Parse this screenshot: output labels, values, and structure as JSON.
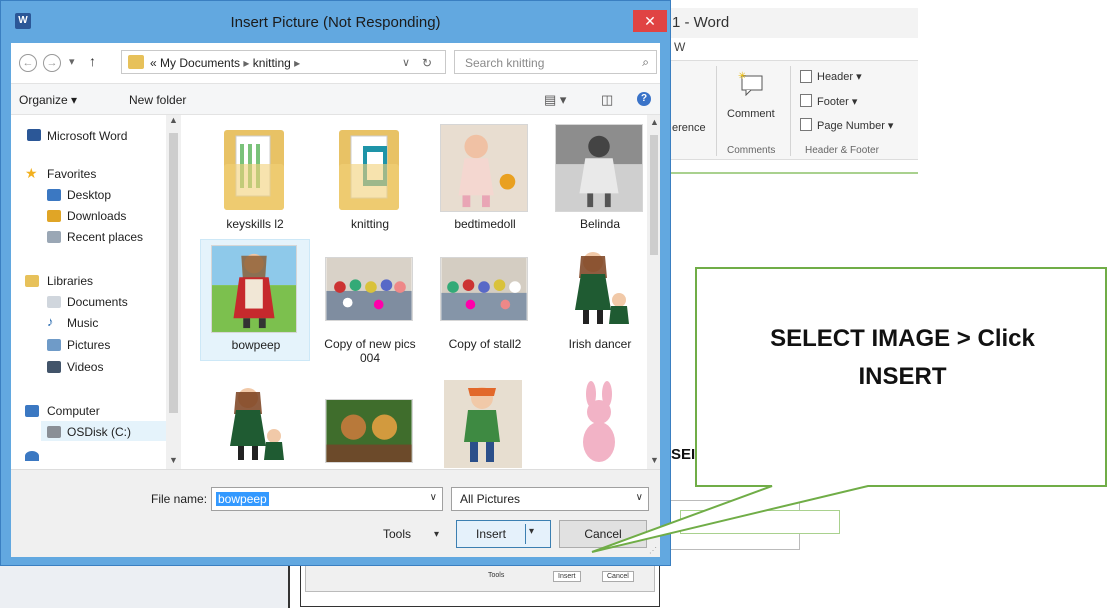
{
  "word": {
    "title": "1 - Word",
    "tab_fragment": "W",
    "ribbon": {
      "reference_fragment": "erence",
      "comment_label": "Comment",
      "comments_group": "Comments",
      "header_label": "Header",
      "footer_label": "Footer",
      "page_number_label": "Page Number",
      "header_footer_group": "Header & Footer"
    },
    "select_fragment": "SEI"
  },
  "dialog": {
    "title": "Insert Picture (Not Responding)",
    "app_icon": "W",
    "breadcrumb": {
      "prefix": "«",
      "parts": [
        "My Documents",
        "knitting"
      ]
    },
    "search_placeholder": "Search knitting",
    "toolbar": {
      "organize": "Organize ▾",
      "new_folder": "New folder"
    },
    "nav": {
      "top_item": "Microsoft Word",
      "favorites": "Favorites",
      "favorites_items": [
        "Desktop",
        "Downloads",
        "Recent places"
      ],
      "libraries": "Libraries",
      "libraries_items": [
        "Documents",
        "Music",
        "Pictures",
        "Videos"
      ],
      "computer": "Computer",
      "computer_items": [
        "OSDisk (C:)"
      ]
    },
    "files": [
      {
        "label": "keyskills l2",
        "kind": "folder"
      },
      {
        "label": "knitting",
        "kind": "folder"
      },
      {
        "label": "bedtimedoll",
        "kind": "image"
      },
      {
        "label": "Belinda",
        "kind": "image"
      },
      {
        "label": "bowpeep",
        "kind": "image",
        "selected": true
      },
      {
        "label": "Copy of new pics 004",
        "kind": "image"
      },
      {
        "label": "Copy of stall2",
        "kind": "image"
      },
      {
        "label": "Irish dancer",
        "kind": "image"
      },
      {
        "label": "",
        "kind": "image"
      },
      {
        "label": "",
        "kind": "image"
      },
      {
        "label": "",
        "kind": "image"
      },
      {
        "label": "",
        "kind": "image"
      }
    ],
    "file_name_label": "File name:",
    "file_name_value": "bowpeep",
    "file_type": "All Pictures",
    "tools_label": "Tools",
    "insert_label": "Insert",
    "cancel_label": "Cancel"
  },
  "background_mini": {
    "tools": "Tools",
    "insert": "Insert",
    "cancel": "Cancel"
  },
  "callout": {
    "line1": "SELECT IMAGE > Click",
    "line2": "INSERT"
  },
  "colors": {
    "dialog_frame": "#62a8e0",
    "close_button": "#e04343",
    "callout_border": "#70ad47",
    "selection": "#e5f3fb"
  }
}
